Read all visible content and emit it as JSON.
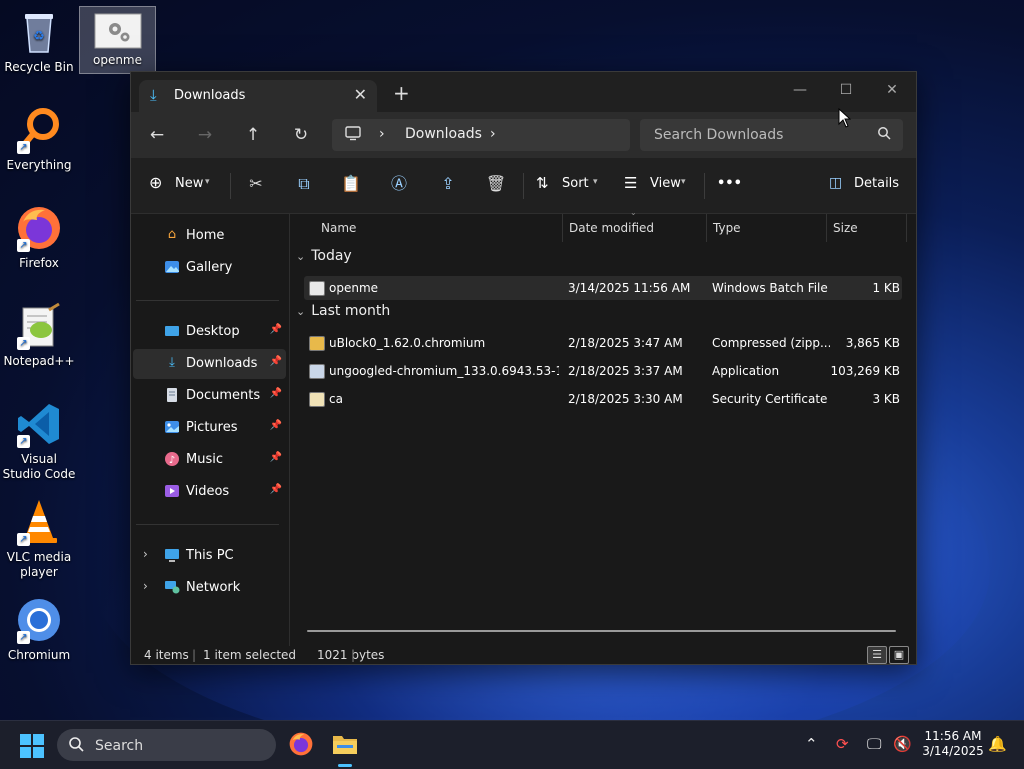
{
  "desktop": {
    "icons": [
      {
        "label": "Recycle Bin"
      },
      {
        "label": "openme"
      },
      {
        "label": "Everything"
      },
      {
        "label": "Firefox"
      },
      {
        "label": "Notepad++"
      },
      {
        "label": "Visual Studio Code"
      },
      {
        "label": "VLC media player"
      },
      {
        "label": "Chromium"
      }
    ]
  },
  "window": {
    "tab_title": "Downloads",
    "tab_close": "✕",
    "new_tab": "+",
    "controls": {
      "minimize": "—",
      "maximize": "☐",
      "close": "✕"
    },
    "nav": {
      "back": "←",
      "forward": "→",
      "up": "↑",
      "refresh": "↻"
    },
    "address": {
      "location": "Downloads",
      "chevron": "›"
    },
    "search": {
      "placeholder": "Search Downloads"
    },
    "toolbar": {
      "new_label": "New",
      "sort_label": "Sort",
      "view_label": "View",
      "more_label": "•••",
      "details_label": "Details"
    },
    "sidebar": {
      "items": [
        {
          "label": "Home"
        },
        {
          "label": "Gallery"
        },
        {
          "label": "Desktop"
        },
        {
          "label": "Downloads"
        },
        {
          "label": "Documents"
        },
        {
          "label": "Pictures"
        },
        {
          "label": "Music"
        },
        {
          "label": "Videos"
        },
        {
          "label": "This PC"
        },
        {
          "label": "Network"
        }
      ]
    },
    "columns": [
      "Name",
      "Date modified",
      "Type",
      "Size"
    ],
    "groups": [
      {
        "label": "Today",
        "files": [
          {
            "name": "openme",
            "date": "3/14/2025 11:56 AM",
            "type": "Windows Batch File",
            "size": "1 KB",
            "selected": true
          }
        ]
      },
      {
        "label": "Last month",
        "files": [
          {
            "name": "uBlock0_1.62.0.chromium",
            "date": "2/18/2025 3:47 AM",
            "type": "Compressed (zipp...",
            "size": "3,865 KB"
          },
          {
            "name": "ungoogled-chromium_133.0.6943.53-1.1...",
            "date": "2/18/2025 3:37 AM",
            "type": "Application",
            "size": "103,269 KB"
          },
          {
            "name": "ca",
            "date": "2/18/2025 3:30 AM",
            "type": "Security Certificate",
            "size": "3 KB"
          }
        ]
      }
    ],
    "status": {
      "items": "4 items",
      "selected": "1 item selected",
      "size": "1021 bytes"
    }
  },
  "taskbar": {
    "search_placeholder": "Search",
    "time": "11:56 AM",
    "date": "3/14/2025"
  },
  "colors": {
    "accent": "#4cc2ff",
    "window_bg": "#191919",
    "folder": "#e8b94a"
  }
}
